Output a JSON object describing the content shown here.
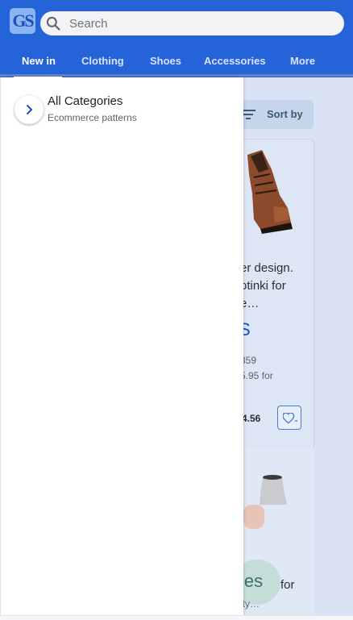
{
  "header": {
    "logo_text": "GS",
    "search": {
      "placeholder": "Search",
      "value": ""
    },
    "tabs": [
      {
        "label": "New in",
        "active": true
      },
      {
        "label": "Clothing",
        "active": false
      },
      {
        "label": "Shoes",
        "active": false
      },
      {
        "label": "Accessories",
        "active": false
      },
      {
        "label": "More",
        "active": false
      }
    ]
  },
  "drawer": {
    "items": [
      {
        "title": "All Categories",
        "subtitle": "Ecommerce patterns"
      }
    ]
  },
  "background": {
    "sort_label": "Sort by",
    "product_1": {
      "description": "er design. otinki for e…",
      "description_lines": [
        "er design.",
        "otinki for",
        "e…"
      ],
      "price_big": "S",
      "old_lines": [
        "359",
        "5.95 for"
      ],
      "price_small": "4.56"
    },
    "product_2": {
      "badge": "ies",
      "for_text": "for",
      "sub_text": "ity…"
    }
  },
  "colors": {
    "header_bg": "#2563d9",
    "accent": "#1e4fc2",
    "scrim": "#d9e3f5"
  }
}
